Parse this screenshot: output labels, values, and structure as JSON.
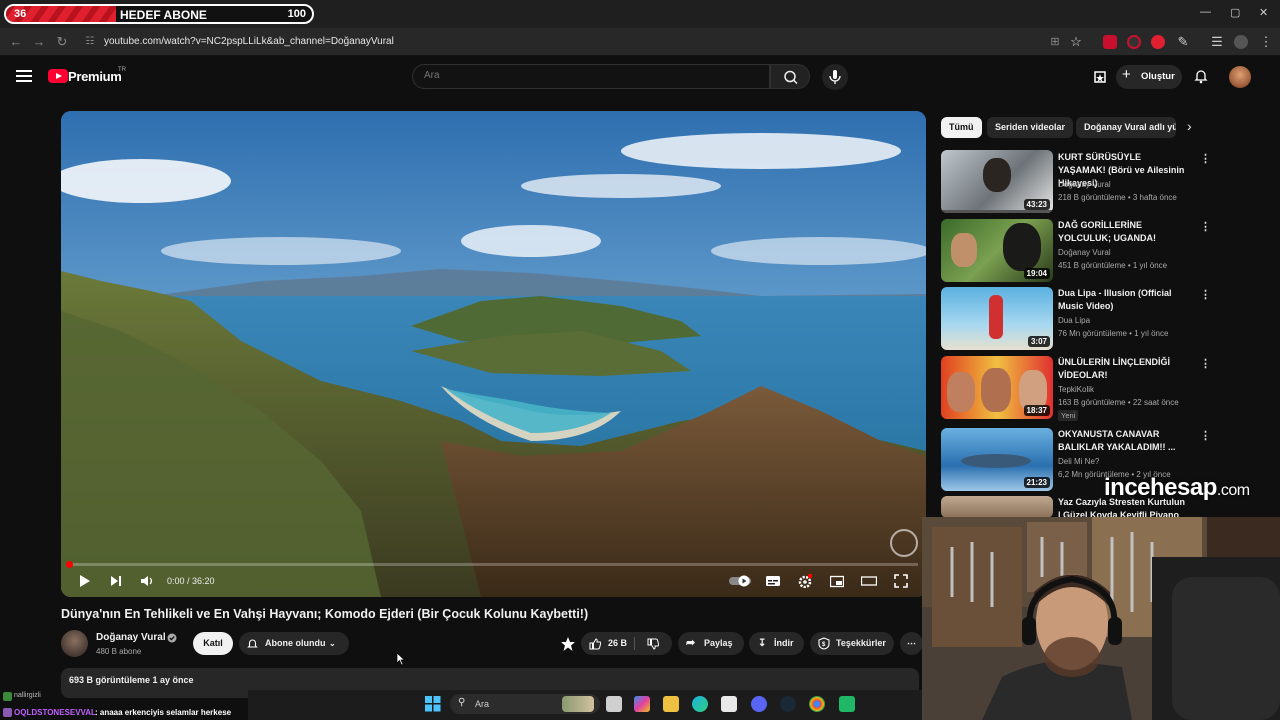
{
  "overlay": {
    "goal_current": "36",
    "goal_title": "HEDEF ABONE",
    "goal_max": "100",
    "goal_progress": 0.36,
    "brand_main": "incehesap",
    "brand_suffix": ".com"
  },
  "browser": {
    "url": "youtube.com/watch?v=NC2pspLLiLk&ab_channel=DoğanayVural"
  },
  "header": {
    "logo_text": "Premium",
    "logo_country": "TR",
    "search_placeholder": "Ara",
    "create_label": "Oluştur"
  },
  "player": {
    "time": "0:00 / 36:20",
    "progress": 0
  },
  "video": {
    "title": "Dünya'nın En Tehlikeli ve En Vahşi Hayvanı; Komodo Ejderi (Bir Çocuk Kolunu Kaybetti!)",
    "channel": "Doğanay Vural",
    "subscribers": "480 B abone",
    "join_label": "Katıl",
    "subscribed_label": "Abone olundu",
    "likes": "26 B",
    "share_label": "Paylaş",
    "download_label": "İndir",
    "thanks_label": "Teşekkürler",
    "meta": "693 B görüntüleme  1 ay önce"
  },
  "sidebar": {
    "chips": [
      "Tümü",
      "Seriden videolar",
      "Doğanay Vural adlı yü"
    ],
    "recs": [
      {
        "title": "KURT SÜRÜSÜYLE YAŞAMAK! (Börü ve Ailesinin Hikayesi)",
        "channel": "Doğanay Vural",
        "meta": "218 B görüntüleme • 3 hafta önce",
        "duration": "43:23"
      },
      {
        "title": "DAĞ GORİLLERİNE YOLCULUK; UGANDA!",
        "channel": "Doğanay Vural",
        "meta": "451 B görüntüleme • 1 yıl önce",
        "duration": "19:04"
      },
      {
        "title": "Dua Lipa - Illusion (Official Music Video)",
        "channel": "Dua Lipa",
        "meta": "76 Mn görüntüleme • 1 yıl önce",
        "duration": "3:07"
      },
      {
        "title": "ÜNLÜLERİN LİNÇLENDİĞİ VİDEOLAR!",
        "channel": "TepkiKolik",
        "meta": "163 B görüntüleme • 22 saat önce",
        "duration": "18:37",
        "badge": "Yeni"
      },
      {
        "title": "OKYANUSTA CANAVAR BALIKLAR YAKALADIM!! ...",
        "channel": "Deli Mi Ne?",
        "meta": "6,2 Mn görüntüleme • 2 yıl önce",
        "duration": "21:23"
      },
      {
        "title": "Yaz Cazıyla Stresten Kurtulun | Güzel Kovda Keyifli Piyano Ca...",
        "channel": "",
        "meta": "",
        "duration": ""
      }
    ]
  },
  "taskbar": {
    "search_label": "Ara"
  },
  "chat": {
    "top_user": "nallirgizli",
    "user": "OQLDSTONESEVVAL",
    "message": ": anaaa erkenciyis selamlar herkese"
  }
}
